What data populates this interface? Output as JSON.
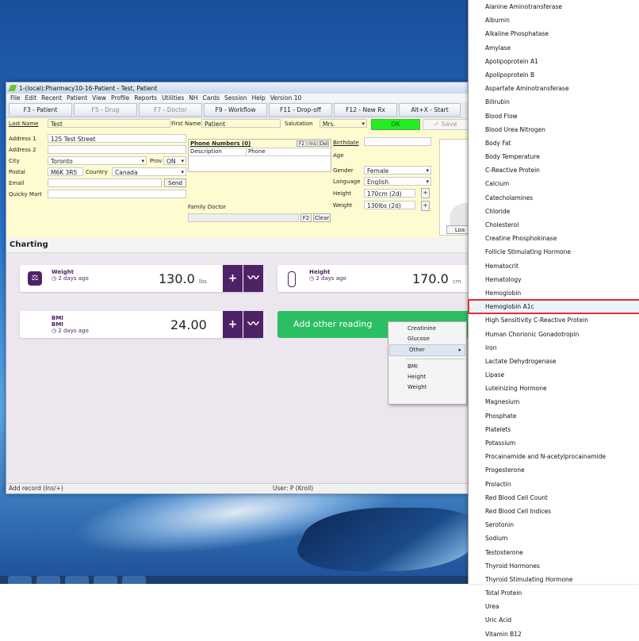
{
  "window": {
    "title": "1-(local):Pharmacy10-16-Patient - Test, Patient"
  },
  "menu": [
    "File",
    "Edit",
    "Recent",
    "Patient",
    "View",
    "Profile",
    "Reports",
    "Utilities",
    "NH",
    "Cards",
    "Session",
    "Help",
    "Version 10"
  ],
  "toolbar": {
    "patient": "F3 - Patient",
    "drug": "F5 - Drug",
    "doctor": "F7 - Doctor",
    "workflow": "F9 - Workflow",
    "dropoff": "F11 - Drop-off",
    "newrx": "F12 - New Rx",
    "start": "Alt+X - Start"
  },
  "form": {
    "last_name_label": "Last Name",
    "last_name": "Test",
    "first_name_label": "First Name",
    "first_name": "Patient",
    "salutation_label": "Salutation",
    "salutation": "Mrs.",
    "ok": "OK",
    "save": "Save",
    "address1_label": "Address 1",
    "address1": "125 Test Street",
    "address2_label": "Address 2",
    "city_label": "City",
    "city": "Toronto",
    "prov_label": "Prov",
    "prov": "ON",
    "postal_label": "Postal",
    "postal": "M6K 3R5",
    "country_label": "Country",
    "country": "Canada",
    "email_label": "Email",
    "send": "Send",
    "quicky_label": "Quicky Mart",
    "phone_numbers": "Phone Numbers (0)",
    "phone_btns": [
      "F2",
      "Ins",
      "Del"
    ],
    "phone_col_desc": "Description",
    "phone_col_phone": "Phone",
    "birthdate_label": "Birthdate",
    "age_label": "Age",
    "gender_label": "Gender",
    "gender": "Female",
    "language_label": "Language",
    "language": "English",
    "height_label": "Height",
    "height": "170cm (2d)",
    "weight_label": "Weight",
    "weight": "130lbs (2d)",
    "family_doctor_label": "Family Doctor",
    "f2": "F2",
    "clear": "Clear",
    "plus": "+",
    "load": "Loa"
  },
  "charting": {
    "title": "Charting",
    "weight": {
      "name": "Weight",
      "when": "2 days ago",
      "value": "130.0",
      "unit": "lbs"
    },
    "height": {
      "name": "Height",
      "when": "2 days ago",
      "value": "170.0",
      "unit": "cm"
    },
    "bmi": {
      "name": "BMI",
      "sub": "BMI",
      "when": "2 days ago",
      "value": "24.00"
    },
    "add_other": "Add other reading",
    "plus": "+"
  },
  "context_menu": {
    "items_top": [
      "Creatinine",
      "Glucose"
    ],
    "other": "Other",
    "items_bottom": [
      "BMI",
      "Height",
      "Weight"
    ]
  },
  "status": {
    "left": "Add record (Ins/+)",
    "user": "User: P (Kroll)"
  },
  "list": [
    "Alanine Aminotransferase",
    "Albumin",
    "Alkaline Phosphatase",
    "Amylase",
    "Apolipoprotein A1",
    "Apolipoprotein B",
    "Aspartate Aminotransferase",
    "Bilirubin",
    "Blood Flow",
    "Blood Urea Nitrogen",
    "Body Fat",
    "Body Temperature",
    "C-Reactive Protein",
    "Calcium",
    "Catecholamines",
    "Chloride",
    "Cholesterol",
    "Creatine Phosphokinase",
    "Follicle Stimulating Hormone",
    "Hematocrit",
    "Hematology",
    "Hemoglobin",
    "Hemoglobin A1c",
    "High Sensitivity C-Reactive Protein",
    "Human Chorionic Gonadotropin",
    "Iron",
    "Lactate Dehydrogenase",
    "Lipase",
    "Luteinizing Hormone",
    "Magnesium",
    "Phosphate",
    "Platelets",
    "Potassium",
    "Procainamide and N-acetylprocainamide",
    "Progesterone",
    "Prolactin",
    "Red Blood Cell Count",
    "Red Blood Cell Indices",
    "Serotonin",
    "Sodium",
    "Testosterone",
    "Thyroid Hormones",
    "Thyroid Stimulating Hormone",
    "Total Protein",
    "Urea",
    "Uric Acid",
    "Vitamin B12"
  ],
  "selected_index": 22
}
